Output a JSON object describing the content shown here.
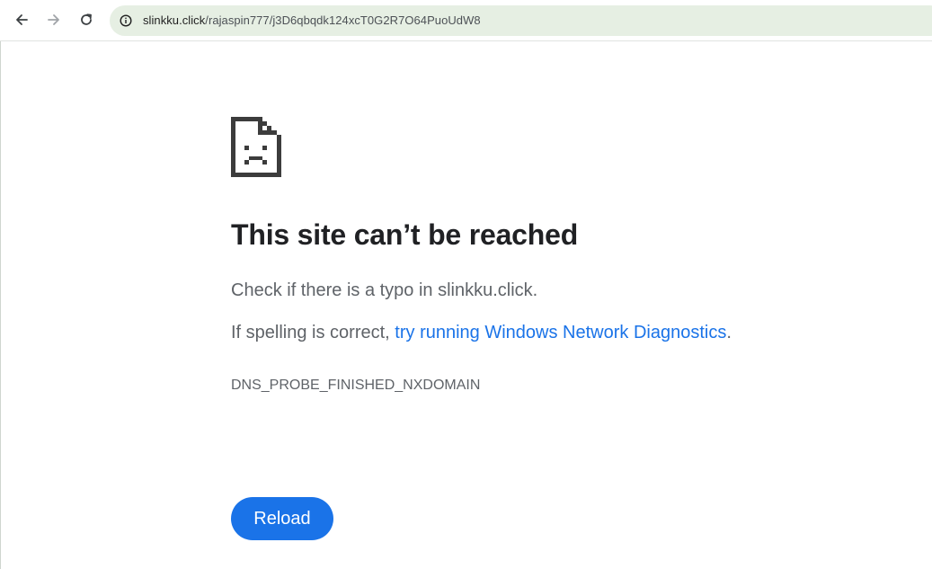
{
  "browser": {
    "back_icon": "arrow-left-icon",
    "forward_icon": "arrow-right-icon",
    "reload_icon": "reload-icon",
    "site_info_icon": "info-circle-icon",
    "url_host": "slinkku.click",
    "url_path": "/rajaspin777/j3D6qbqdk124xcT0G2R7O64PuoUdW8"
  },
  "error_page": {
    "icon": "sad-document-icon",
    "heading": "This site can’t be reached",
    "check_text": "Check if there is a typo in slinkku.click.",
    "spelling_prefix": "If spelling is correct, ",
    "diagnostics_link": "try running Windows Network Diagnostics",
    "spelling_suffix": ".",
    "error_code": "DNS_PROBE_FINISHED_NXDOMAIN",
    "reload_label": "Reload"
  },
  "colors": {
    "accent": "#1a73e8",
    "heading": "#202124",
    "body_text": "#5f6368",
    "omnibox_bg": "#e6efe3",
    "icon": "#3c3c3c"
  }
}
